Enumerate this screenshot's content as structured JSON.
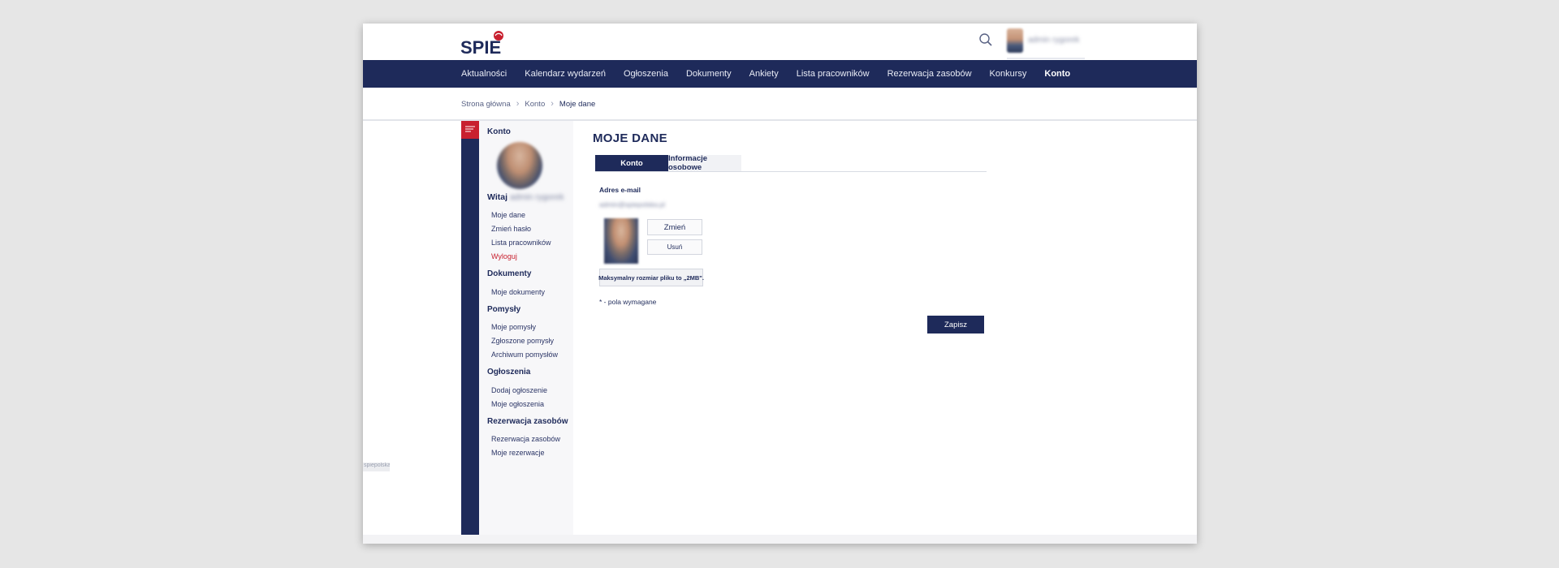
{
  "header": {
    "logo_text": "SPIE",
    "user_name": "admin rygorek"
  },
  "nav": {
    "items": [
      {
        "label": "Aktualności"
      },
      {
        "label": "Kalendarz wydarzeń"
      },
      {
        "label": "Ogłoszenia"
      },
      {
        "label": "Dokumenty"
      },
      {
        "label": "Ankiety"
      },
      {
        "label": "Lista pracowników"
      },
      {
        "label": "Rezerwacja zasobów"
      },
      {
        "label": "Konkursy"
      },
      {
        "label": "Konto"
      }
    ],
    "active": "Konto"
  },
  "breadcrumb": {
    "items": [
      "Strona główna",
      "Konto",
      "Moje dane"
    ]
  },
  "sidebar": {
    "section_account": "Konto",
    "welcome": "Witaj",
    "welcome_name": "admin rygorek",
    "links_account": [
      "Moje dane",
      "Zmień hasło",
      "Lista pracowników",
      "Wyloguj"
    ],
    "section_documents": "Dokumenty",
    "links_documents": [
      "Moje dokumenty"
    ],
    "section_ideas": "Pomysły",
    "links_ideas": [
      "Moje pomysły",
      "Zgłoszone pomysły",
      "Archiwum pomysłów"
    ],
    "section_ads": "Ogłoszenia",
    "links_ads": [
      "Dodaj ogłoszenie",
      "Moje ogłoszenia"
    ],
    "section_reservations": "Rezerwacja zasobów",
    "links_reservations": [
      "Rezerwacja zasobów",
      "Moje rezerwacje"
    ]
  },
  "main": {
    "title": "MOJE DANE",
    "tabs": [
      {
        "label": "Konto"
      },
      {
        "label": "Informacje osobowe"
      }
    ],
    "email_label": "Adres e-mail",
    "email_value": "admin@spiepolska.pl",
    "change_button": "Zmień",
    "remove_button": "Usuń",
    "file_size_note": "Maksymalny rozmiar pliku to „2MB\".",
    "required_note": "* - pola wymagane",
    "save_button": "Zapisz"
  },
  "bottom_tab": "spiepolska",
  "colors": {
    "navy": "#1e2a5a",
    "red": "#c8202f",
    "background": "#e6e6e6"
  }
}
